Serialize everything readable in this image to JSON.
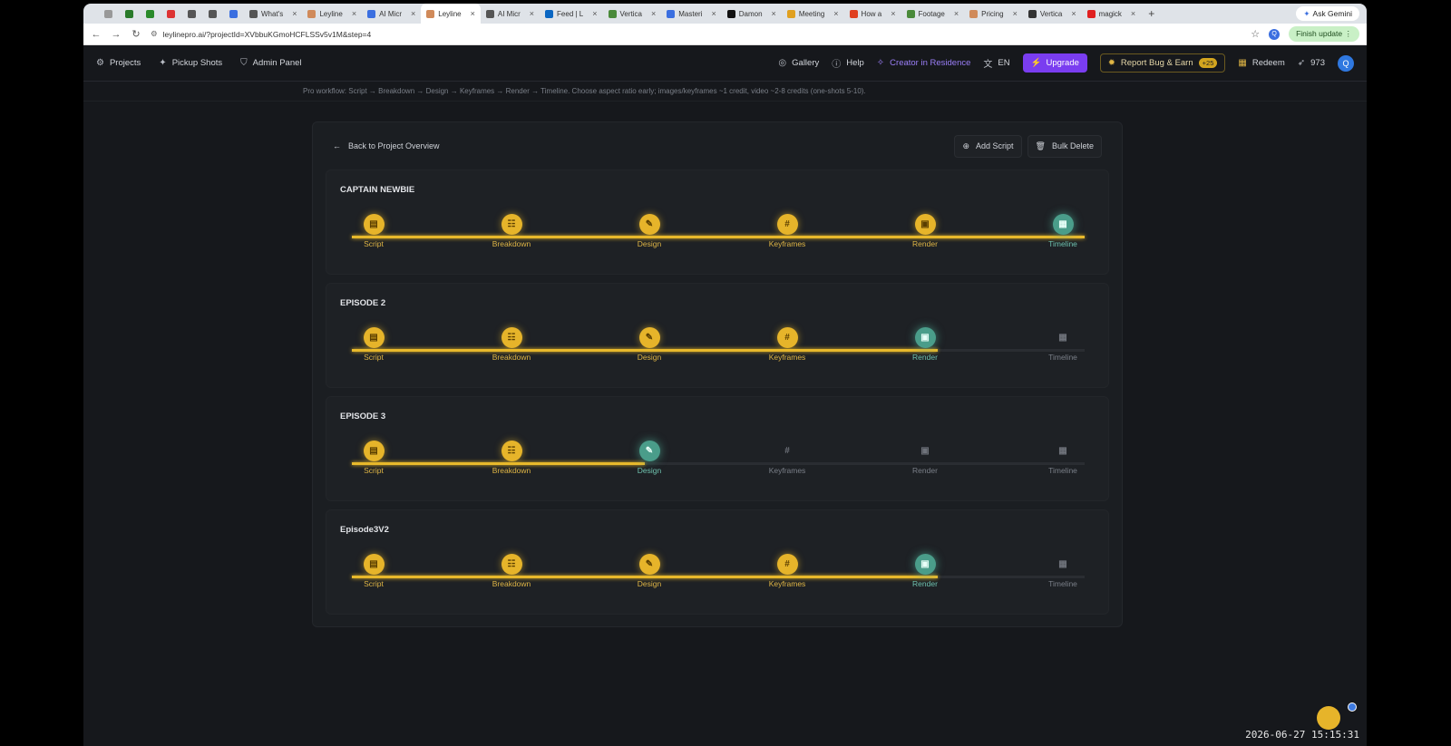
{
  "browser": {
    "tabs": [
      {
        "label": "",
        "color": "#999"
      },
      {
        "label": "",
        "color": "#2a7a2a"
      },
      {
        "label": "",
        "color": "#2a8a2a"
      },
      {
        "label": "",
        "color": "#d33"
      },
      {
        "label": "",
        "color": "#555"
      },
      {
        "label": "",
        "color": "#555"
      },
      {
        "label": "",
        "color": "#3b6fe0"
      },
      {
        "label": "What's",
        "color": "#555"
      },
      {
        "label": "Leyline",
        "color": "#d08a5a"
      },
      {
        "label": "AI Micr",
        "color": "#3b6fe0"
      },
      {
        "label": "Leyline",
        "color": "#d08a5a",
        "active": true
      },
      {
        "label": "AI Micr",
        "color": "#555"
      },
      {
        "label": "Feed | L",
        "color": "#0a66c2"
      },
      {
        "label": "Vertica",
        "color": "#4a8a3a"
      },
      {
        "label": "Masteri",
        "color": "#3b6fe0"
      },
      {
        "label": "Damon",
        "color": "#111"
      },
      {
        "label": "Meeting",
        "color": "#e0a020"
      },
      {
        "label": "How a",
        "color": "#e04020"
      },
      {
        "label": "Footage",
        "color": "#4a8a3a"
      },
      {
        "label": "Pricing",
        "color": "#d08a5a"
      },
      {
        "label": "Vertica",
        "color": "#333"
      },
      {
        "label": "magick",
        "color": "#e02020"
      }
    ],
    "new_tab": "+",
    "ask_gemini": "Ask Gemini",
    "url": "leylinepro.ai/?projectId=XVbbuKGmoHCFLSSv5v1M&step=4",
    "finish_update": "Finish update",
    "profile_initial": "Q"
  },
  "header": {
    "left": [
      {
        "label": "Projects",
        "icon": "⚙"
      },
      {
        "label": "Pickup Shots",
        "icon": "✦"
      },
      {
        "label": "Admin Panel",
        "icon": "⛉"
      }
    ],
    "gallery": "Gallery",
    "help": "Help",
    "creator": "Creator in Residence",
    "lang": "EN",
    "upgrade": "Upgrade",
    "report_bug": "Report Bug & Earn",
    "report_badge": "+25",
    "redeem": "Redeem",
    "credits": "973",
    "avatar": "Q"
  },
  "hint": "Pro workflow: Script → Breakdown → Design → Keyframes → Render → Timeline. Choose aspect ratio early; images/keyframes ~1 credit, video ~2-8 credits (one-shots 5-10).",
  "panel": {
    "back": "Back to Project Overview",
    "add_script": "Add Script",
    "bulk_delete": "Bulk Delete"
  },
  "stage_labels": [
    "Script",
    "Breakdown",
    "Design",
    "Keyframes",
    "Render",
    "Timeline"
  ],
  "stage_icons": [
    "▤",
    "☷",
    "✎",
    "#",
    "▣",
    "▦"
  ],
  "scripts": [
    {
      "title": "CAPTAIN NEWBIE",
      "progress": 1.0,
      "states": [
        "done",
        "done",
        "done",
        "done",
        "done",
        "current"
      ]
    },
    {
      "title": "EPISODE 2",
      "progress": 0.8,
      "states": [
        "done",
        "done",
        "done",
        "done",
        "current",
        "pending"
      ]
    },
    {
      "title": "EPISODE 3",
      "progress": 0.4,
      "states": [
        "done",
        "done",
        "current",
        "pending",
        "pending",
        "pending"
      ]
    },
    {
      "title": "Episode3V2",
      "progress": 0.8,
      "states": [
        "done",
        "done",
        "done",
        "done",
        "current",
        "pending"
      ]
    }
  ],
  "clock": "2026-06-27  15:15:31"
}
